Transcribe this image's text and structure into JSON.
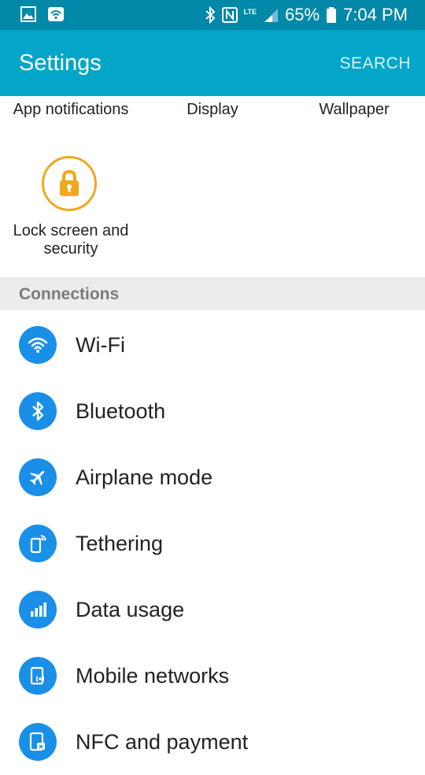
{
  "status_bar": {
    "battery": "65%",
    "time": "7:04 PM",
    "network": "LTE"
  },
  "app_bar": {
    "title": "Settings",
    "search_label": "SEARCH"
  },
  "quick_settings": {
    "items": [
      {
        "label": "App notifications"
      },
      {
        "label": "Display"
      },
      {
        "label": "Wallpaper"
      }
    ],
    "lock_item": {
      "label": "Lock screen and security",
      "icon": "lock-icon"
    }
  },
  "connections": {
    "header": "Connections",
    "items": [
      {
        "label": "Wi-Fi",
        "icon": "wifi-icon"
      },
      {
        "label": "Bluetooth",
        "icon": "bluetooth-icon"
      },
      {
        "label": "Airplane mode",
        "icon": "airplane-icon"
      },
      {
        "label": "Tethering",
        "icon": "tethering-icon"
      },
      {
        "label": "Data usage",
        "icon": "data-usage-icon"
      },
      {
        "label": "Mobile networks",
        "icon": "mobile-networks-icon"
      },
      {
        "label": "NFC and payment",
        "icon": "nfc-icon"
      }
    ]
  },
  "colors": {
    "status_bar": "#0288a8",
    "app_bar": "#03a6c9",
    "accent_blue": "#1a8fe8",
    "lock_accent": "#f2a81d"
  }
}
